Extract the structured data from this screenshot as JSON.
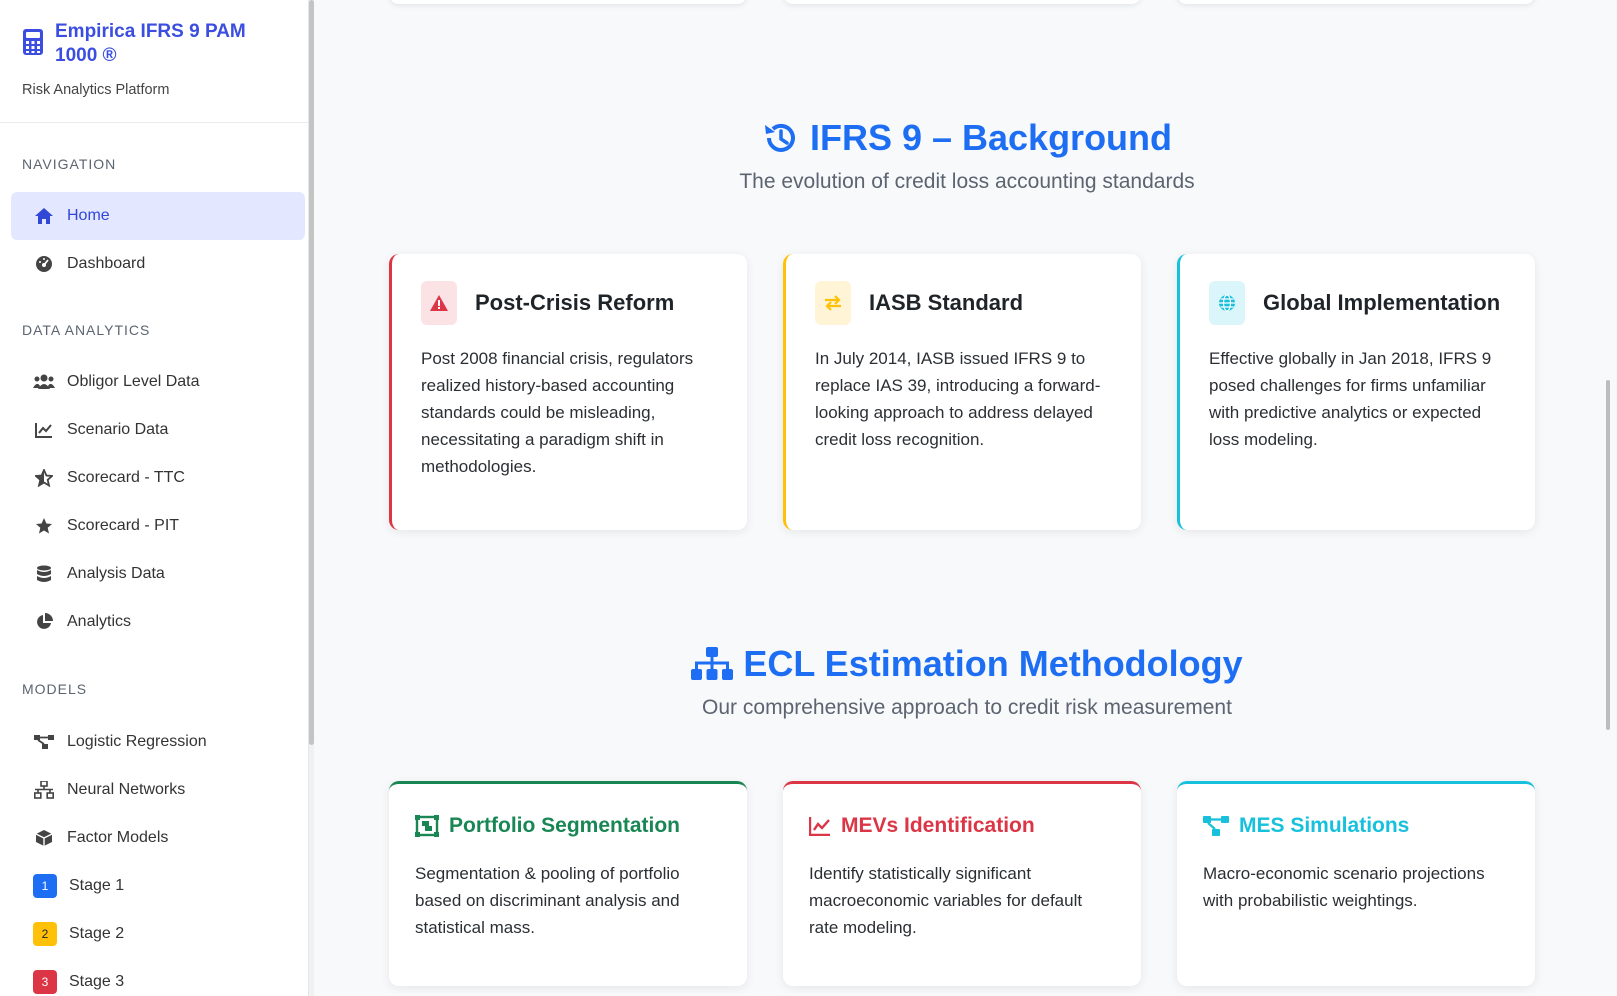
{
  "brand": {
    "title": "Empirica IFRS 9 PAM 1000 ®",
    "subtitle": "Risk Analytics Platform"
  },
  "sidebar": {
    "sections": {
      "navigation": "NAVIGATION",
      "data_analytics": "DATA ANALYTICS",
      "models": "MODELS"
    },
    "items": {
      "home": "Home",
      "dashboard": "Dashboard",
      "obligor": "Obligor Level Data",
      "scenario": "Scenario Data",
      "scorecard_ttc": "Scorecard - TTC",
      "scorecard_pit": "Scorecard - PIT",
      "analysis": "Analysis Data",
      "analytics": "Analytics",
      "logistic": "Logistic Regression",
      "neural": "Neural Networks",
      "factor": "Factor Models",
      "stage1": "Stage 1",
      "stage2": "Stage 2",
      "stage3": "Stage 3"
    },
    "stage_badges": {
      "s1": "1",
      "s2": "2",
      "s3": "3"
    }
  },
  "background": {
    "title": "IFRS 9 – Background",
    "subtitle": "The evolution of credit loss accounting standards",
    "cards": [
      {
        "title": "Post-Crisis Reform",
        "text": "Post 2008 financial crisis, regulators realized history-based accounting standards could be misleading, necessitating a paradigm shift in methodologies."
      },
      {
        "title": "IASB Standard",
        "text": "In July 2014, IASB issued IFRS 9 to replace IAS 39, introducing a forward-looking approach to address delayed credit loss recognition."
      },
      {
        "title": "Global Implementation",
        "text": "Effective globally in Jan 2018, IFRS 9 posed challenges for firms unfamiliar with predictive analytics or expected loss modeling."
      }
    ]
  },
  "methodology": {
    "title": "ECL Estimation Methodology",
    "subtitle": "Our comprehensive approach to credit risk measurement",
    "cards": [
      {
        "title": "Portfolio Segmentation",
        "text": "Segmentation & pooling of portfolio based on discriminant analysis and statistical mass."
      },
      {
        "title": "MEVs Identification",
        "text": "Identify statistically significant macroeconomic variables for default rate modeling."
      },
      {
        "title": "MES Simulations",
        "text": "Macro-economic scenario projections with probabilistic weightings."
      }
    ]
  },
  "colors": {
    "primary": "#1d6ef3",
    "brand": "#3b4ee0",
    "red": "#dc3545",
    "yellow": "#ffc107",
    "cyan": "#17c1dc",
    "green": "#198754"
  }
}
